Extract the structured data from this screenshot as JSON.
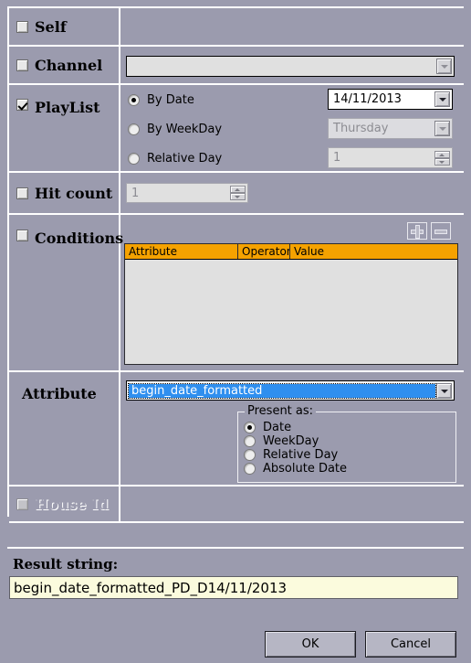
{
  "dialog": {
    "rows": {
      "self": {
        "label": "Self",
        "checked": false,
        "enabled": true
      },
      "channel": {
        "label": "Channel",
        "checked": false,
        "enabled": true
      },
      "playlist": {
        "label": "PlayList",
        "checked": true,
        "enabled": true
      },
      "hitcount": {
        "label": "Hit count",
        "checked": false,
        "enabled": true
      },
      "conditions": {
        "label": "Conditions",
        "checked": false,
        "enabled": true
      },
      "attribute": {
        "label": "Attribute"
      },
      "houseid": {
        "label": "House Id",
        "checked": false,
        "enabled": false
      }
    },
    "channel_combo": {
      "value": "",
      "placeholder": ""
    },
    "playlist": {
      "options": [
        {
          "label": "By Date",
          "selected": true
        },
        {
          "label": "By WeekDay",
          "selected": false
        },
        {
          "label": "Relative Day",
          "selected": false
        }
      ],
      "by_date_value": "14/11/2013",
      "by_weekday_value": "Thursday",
      "relative_day_value": "1"
    },
    "hitcount_value": "1",
    "conditions": {
      "add_button": "add-condition",
      "remove_button": "remove-condition",
      "columns": [
        "Attribute",
        "Operator",
        "Value"
      ],
      "rows": []
    },
    "attribute_combo": {
      "value": "begin_date_formatted"
    },
    "present_as": {
      "title": "Present as:",
      "options": [
        {
          "label": "Date",
          "selected": true
        },
        {
          "label": "WeekDay",
          "selected": false
        },
        {
          "label": "Relative Day",
          "selected": false
        },
        {
          "label": "Absolute Date",
          "selected": false
        }
      ]
    },
    "result": {
      "label": "Result string:",
      "value": "begin_date_formatted_PD_D14/11/2013"
    },
    "buttons": {
      "ok": "OK",
      "cancel": "Cancel"
    },
    "colors": {
      "window": "#9b9bae",
      "header_orange": "#f5a200",
      "selection_blue": "#2f8fef",
      "result_bg": "#fbfbdd"
    }
  }
}
